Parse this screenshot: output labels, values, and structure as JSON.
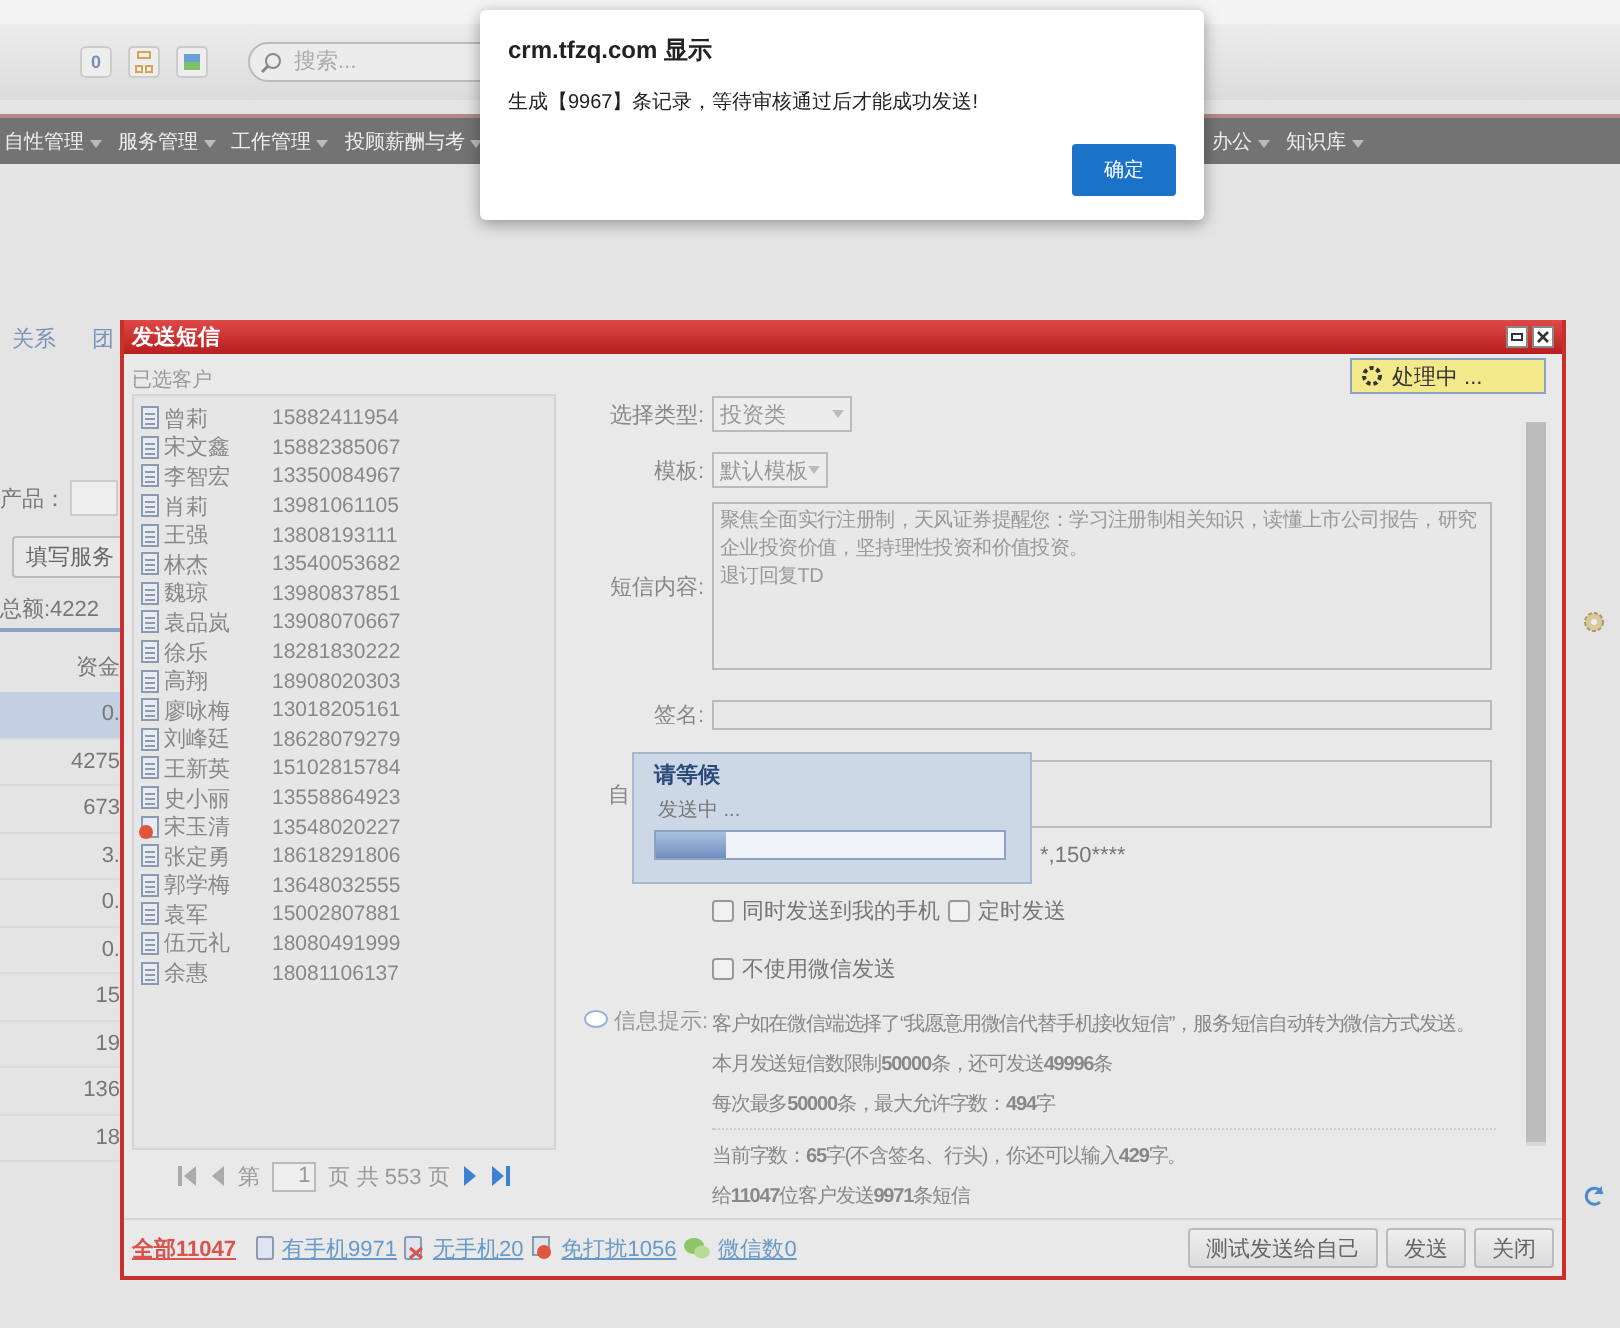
{
  "toolbar": {
    "counter": "0",
    "search": {
      "placeholder": "搜索..."
    }
  },
  "nav_left": [
    {
      "label": "自性管理"
    },
    {
      "label": "服务管理"
    },
    {
      "label": "工作管理"
    },
    {
      "label": "投顾薪酬与考"
    }
  ],
  "nav_right": [
    {
      "label": "办公"
    },
    {
      "label": "知识库"
    }
  ],
  "page": {
    "tabs": [
      {
        "label": "关系"
      },
      {
        "label": "团"
      }
    ],
    "product_label": "产品：",
    "fill_button": "填写服务",
    "total": "总额:4222",
    "column_header": "资金",
    "rows": [
      {
        "value": "0.",
        "selected": true
      },
      {
        "value": "4275",
        "selected": false
      },
      {
        "value": "673",
        "selected": false
      },
      {
        "value": "3.",
        "selected": false
      },
      {
        "value": "0.",
        "selected": false
      },
      {
        "value": "0.",
        "selected": false
      },
      {
        "value": "15",
        "selected": false
      },
      {
        "value": "19",
        "selected": false
      },
      {
        "value": "136",
        "selected": false
      },
      {
        "value": "18",
        "selected": false
      }
    ]
  },
  "dialog": {
    "title": "发送短信",
    "status": "处理中 ...",
    "customers_label": "已选客户",
    "customers": [
      {
        "name": "曾莉",
        "phone": "15882411954",
        "kind": "contact"
      },
      {
        "name": "宋文鑫",
        "phone": "15882385067",
        "kind": "contact"
      },
      {
        "name": "李智宏",
        "phone": "13350084967",
        "kind": "contact"
      },
      {
        "name": "肖莉",
        "phone": "13981061105",
        "kind": "contact"
      },
      {
        "name": "王强",
        "phone": "13808193111",
        "kind": "contact"
      },
      {
        "name": "林杰",
        "phone": "13540053682",
        "kind": "contact"
      },
      {
        "name": "魏琼",
        "phone": "13980837851",
        "kind": "contact"
      },
      {
        "name": "袁品岚",
        "phone": "13908070667",
        "kind": "contact"
      },
      {
        "name": "徐乐",
        "phone": "18281830222",
        "kind": "contact"
      },
      {
        "name": "高翔",
        "phone": "18908020303",
        "kind": "contact"
      },
      {
        "name": "廖咏梅",
        "phone": "13018205161",
        "kind": "contact"
      },
      {
        "name": "刘峰廷",
        "phone": "18628079279",
        "kind": "contact"
      },
      {
        "name": "王新英",
        "phone": "15102815784",
        "kind": "contact"
      },
      {
        "name": "史小丽",
        "phone": "13558864923",
        "kind": "contact"
      },
      {
        "name": "宋玉清",
        "phone": "13548020227",
        "kind": "blocked"
      },
      {
        "name": "张定勇",
        "phone": "18618291806",
        "kind": "contact"
      },
      {
        "name": "郭学梅",
        "phone": "13648032555",
        "kind": "contact"
      },
      {
        "name": "袁军",
        "phone": "15002807881",
        "kind": "contact"
      },
      {
        "name": "伍元礼",
        "phone": "18080491999",
        "kind": "contact"
      },
      {
        "name": "余惠",
        "phone": "18081106137",
        "kind": "contact"
      }
    ],
    "pager": {
      "prefix": "第",
      "page": "1",
      "suffix": "页 共 553 页"
    },
    "form": {
      "type_label": "选择类型:",
      "type_value": "投资类",
      "template_label": "模板:",
      "template_value": "默认模板",
      "content_label": "短信内容:",
      "content_lines": [
        "聚焦全面实行注册制，天风证券提醒您：学习注册制相关知识，读懂上市公司报告，研究企业投资价值，坚持理性投资和价值投资。",
        "退订回复TD"
      ],
      "signature_label": "签名:",
      "custom_label": "自",
      "masked_numbers": "*,150****",
      "option_rows": [
        [
          {
            "label": "同时发送到我的手机",
            "checked": false
          },
          {
            "label": "定时发送",
            "checked": false
          }
        ],
        [
          {
            "label": "不使用微信发送",
            "checked": false
          }
        ]
      ],
      "info_label": "信息提示:",
      "info_lines": [
        "客户如在微信端选择了“我愿意用微信代替手机接收短信”，服务短信自动转为微信方式发送。",
        "本月发送短信数限制**50000**条，还可发送**49996**条",
        "每次最多**50000**条，最大允许字数：**494**字"
      ],
      "count_lines": [
        "当前字数：**65**字(不含签名、行头)，你还可以输入**429**字。",
        "给**11047**位客户发送**9971**条短信"
      ]
    },
    "stats": [
      {
        "label": "全部11047",
        "kind": "all"
      },
      {
        "label": "有手机9971",
        "kind": "mobile"
      },
      {
        "label": "无手机20",
        "kind": "no_mobile"
      },
      {
        "label": "免打扰1056",
        "kind": "dnd"
      },
      {
        "label": "微信数0",
        "kind": "wechat"
      }
    ],
    "buttons": [
      {
        "label": "测试发送给自己"
      },
      {
        "label": "发送"
      },
      {
        "label": "关闭"
      }
    ],
    "wait": {
      "title": "请等候",
      "message": "发送中 ...",
      "level": 0.2
    }
  },
  "alert": {
    "title": "crm.tfzq.com 显示",
    "message": "生成【9967】条记录，等待审核通过后才能成功发送!",
    "button": "确定"
  }
}
